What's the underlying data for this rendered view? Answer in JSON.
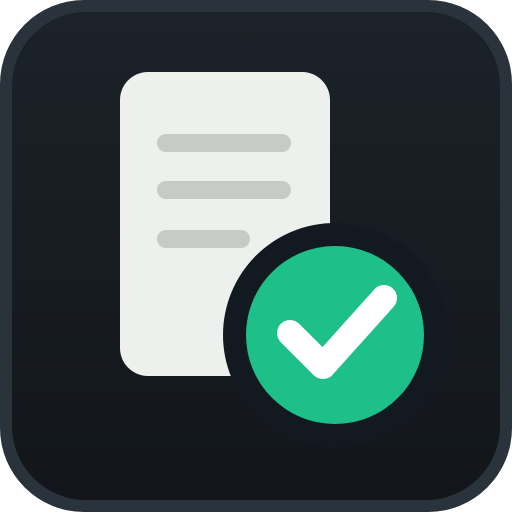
{
  "icon": {
    "names": {
      "tile": "rounded-square-tile",
      "document": "document-icon",
      "badge": "checkmark-badge-icon"
    },
    "colors": {
      "tile_border": "#2a323b",
      "tile_fill": "#161b21",
      "document_fill": "#eef0ee",
      "text_lines": "#c6cbc7",
      "badge_ring": "#131920",
      "badge_fill": "#1ec08a",
      "checkmark": "#ffffff"
    }
  }
}
